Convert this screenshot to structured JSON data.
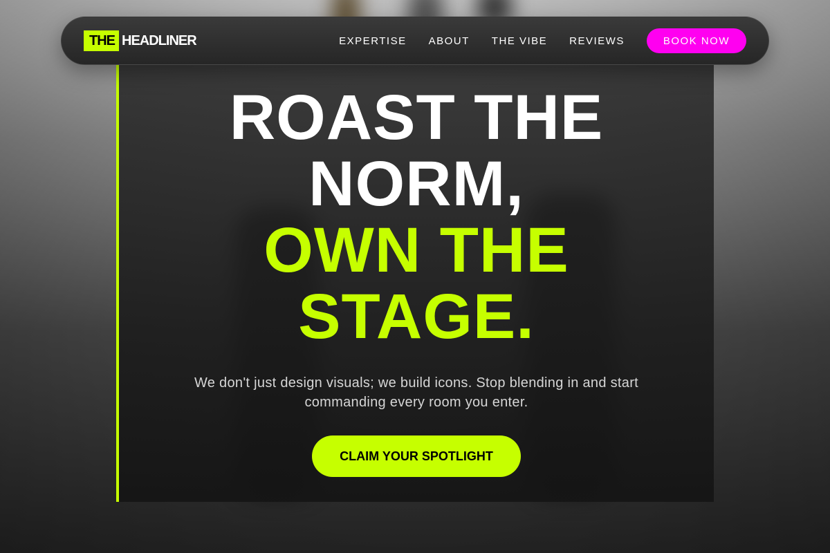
{
  "nav": {
    "logo_highlight": "THE",
    "logo_text": "HEADLINER",
    "links": [
      "EXPERTISE",
      "ABOUT",
      "THE VIBE",
      "REVIEWS"
    ],
    "book_label": "BOOK NOW"
  },
  "hero": {
    "headline_line1": "ROAST THE",
    "headline_line2": "NORM,",
    "headline_line3": "OWN THE",
    "headline_line4": "STAGE.",
    "subtext": "We don't just design visuals; we build icons. Stop blending in and start commanding every room you enter.",
    "cta_label": "CLAIM YOUR SPOTLIGHT"
  },
  "colors": {
    "accent_lime": "#c6ff00",
    "accent_magenta": "#ff00f0",
    "panel_dark": "#1e1e1e"
  }
}
